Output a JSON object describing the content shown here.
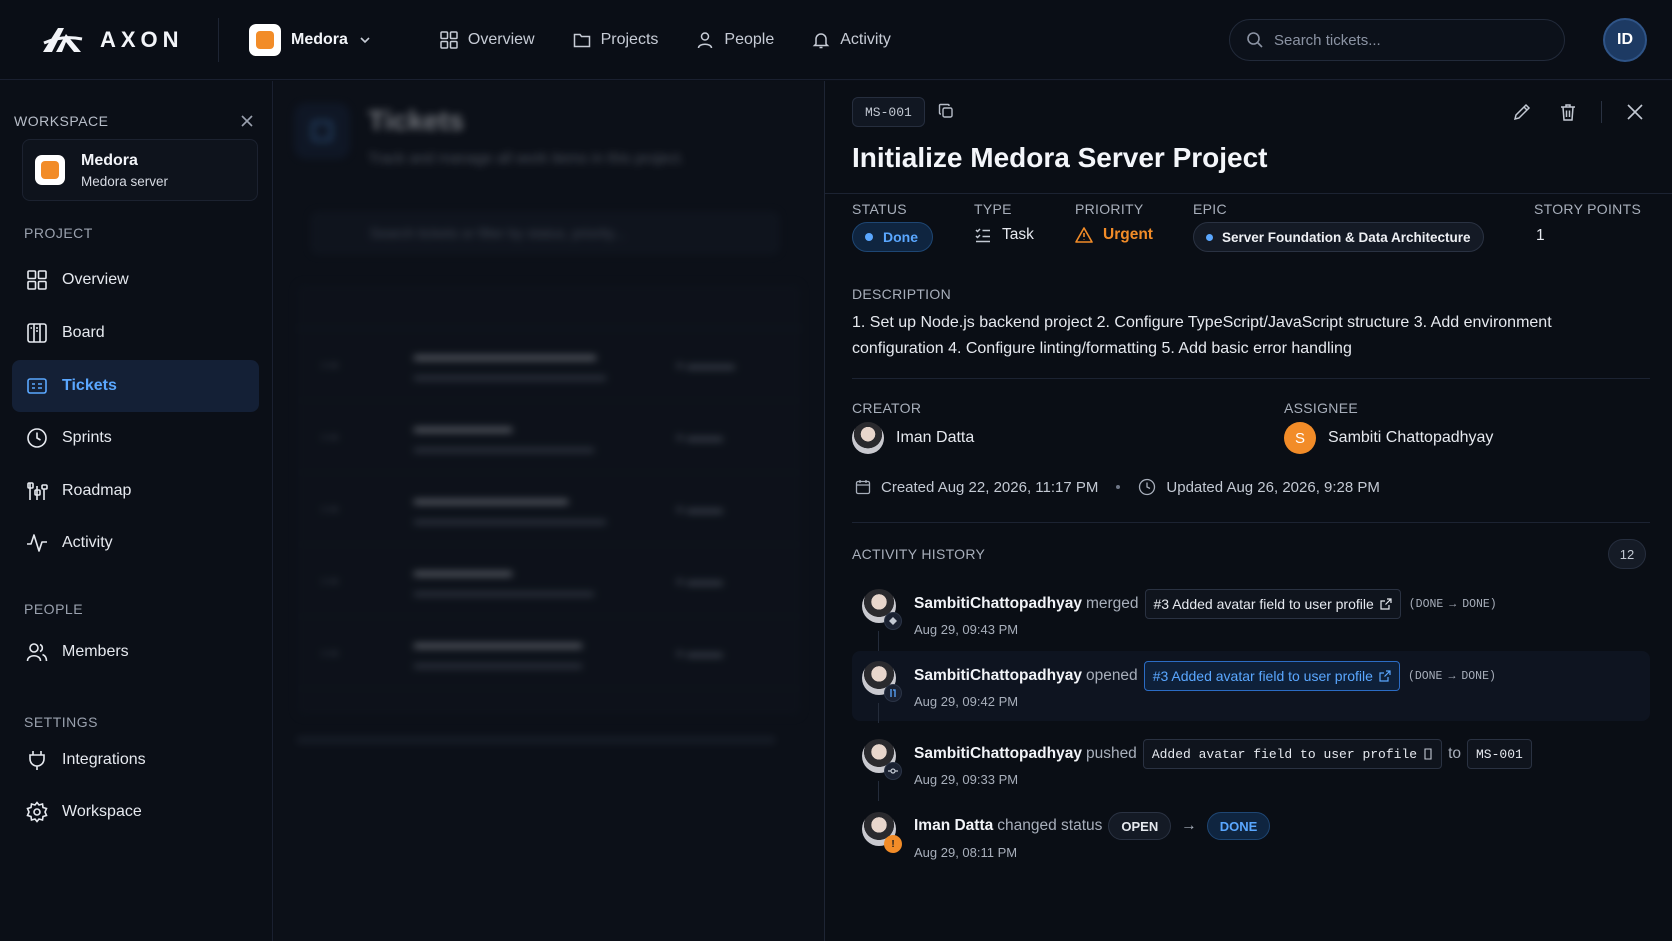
{
  "topbar": {
    "brand": "AXON",
    "workspace": "Medora",
    "nav": [
      {
        "label": "Overview",
        "icon": "grid-icon"
      },
      {
        "label": "Projects",
        "icon": "folder-icon"
      },
      {
        "label": "People",
        "icon": "user-icon"
      },
      {
        "label": "Activity",
        "icon": "bell-icon"
      }
    ],
    "search_placeholder": "Search tickets...",
    "avatar_initials": "ID"
  },
  "sidebar": {
    "workspace_header": "WORKSPACE",
    "workspace_name": "Medora",
    "workspace_sub": "Medora server",
    "project_section": "PROJECT",
    "project_items": [
      {
        "label": "Overview",
        "icon": "grid-icon"
      },
      {
        "label": "Board",
        "icon": "board-icon"
      },
      {
        "label": "Tickets",
        "icon": "ticket-icon",
        "active": true
      },
      {
        "label": "Sprints",
        "icon": "clock-icon"
      },
      {
        "label": "Roadmap",
        "icon": "roadmap-icon"
      },
      {
        "label": "Activity",
        "icon": "pulse-icon"
      }
    ],
    "people_section": "PEOPLE",
    "people_items": [
      {
        "label": "Members",
        "icon": "members-icon"
      }
    ],
    "settings_section": "SETTINGS",
    "settings_items": [
      {
        "label": "Integrations",
        "icon": "plug-icon"
      },
      {
        "label": "Workspace",
        "icon": "gear-icon"
      }
    ]
  },
  "tickets": {
    "title": "Tickets",
    "subtitle": "Track and manage all work items in this project.",
    "search_placeholder": "Search tickets or filter by status, priority..."
  },
  "ticket": {
    "id": "MS-001",
    "title": "Initialize Medora Server Project",
    "status_label": "STATUS",
    "status": "Done",
    "type_label": "TYPE",
    "type": "Task",
    "priority_label": "PRIORITY",
    "priority": "Urgent",
    "epic_label": "EPIC",
    "epic": "Server Foundation & Data Architecture",
    "points_label": "STORY POINTS",
    "points": "1",
    "description_label": "DESCRIPTION",
    "description": "1. Set up Node.js backend project 2. Configure TypeScript/JavaScript structure 3. Add environment configuration 4. Configure linting/formatting 5. Add basic error handling",
    "creator_label": "CREATOR",
    "creator": "Iman Datta",
    "assignee_label": "ASSIGNEE",
    "assignee": "Sambiti Chattopadhyay",
    "assignee_initial": "S",
    "created": "Created Aug 22, 2026, 11:17 PM",
    "updated": "Updated Aug 26, 2026, 9:28 PM"
  },
  "activity": {
    "label": "ACTIVITY HISTORY",
    "count": "12",
    "items": [
      {
        "who": "SambitiChattopadhyay",
        "verb": "merged",
        "chip": "#3 Added avatar field to user profile",
        "from": "(DONE",
        "to": "DONE)",
        "time": "Aug 29, 09:43 PM"
      },
      {
        "who": "SambitiChattopadhyay",
        "verb": "opened",
        "chip": "#3 Added avatar field to user profile",
        "from": "(DONE",
        "to": "DONE)",
        "time": "Aug 29, 09:42 PM"
      },
      {
        "who": "SambitiChattopadhyay",
        "verb": "pushed",
        "chip": "Added avatar field to user profile",
        "connector": "to",
        "target": "MS-001",
        "time": "Aug 29, 09:33 PM"
      },
      {
        "who": "Iman Datta",
        "verb": "changed status",
        "from_status": "OPEN",
        "to_status": "DONE",
        "time": "Aug 29, 08:11 PM"
      }
    ]
  },
  "colors": {
    "accent": "#5aa7ff",
    "urgent": "#f28c28",
    "background": "#0b0f17"
  }
}
